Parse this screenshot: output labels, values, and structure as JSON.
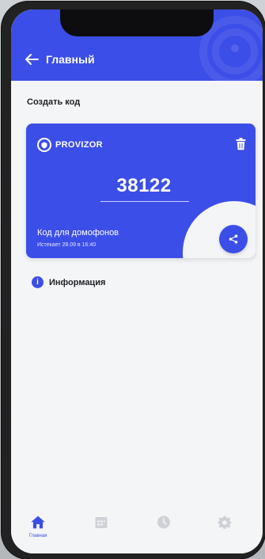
{
  "header": {
    "title": "Главный"
  },
  "content": {
    "section_title": "Создать код"
  },
  "code_card": {
    "brand": "PROVIZOR",
    "code": "38122",
    "type_label": "Код для домофонов",
    "expiry": "Истекает 28.09 в 16:40"
  },
  "info": {
    "label": "Информация",
    "icon_glyph": "i"
  },
  "bottom_nav": {
    "items": [
      {
        "label": "Главная",
        "icon": "home-icon",
        "active": true
      },
      {
        "label": "",
        "icon": "calendar-icon",
        "active": false
      },
      {
        "label": "",
        "icon": "clock-icon",
        "active": false
      },
      {
        "label": "",
        "icon": "settings-gear-icon",
        "active": false
      }
    ]
  },
  "colors": {
    "accent": "#3c4ee8",
    "background": "#f4f5f7",
    "inactive": "#cfd1d7"
  }
}
